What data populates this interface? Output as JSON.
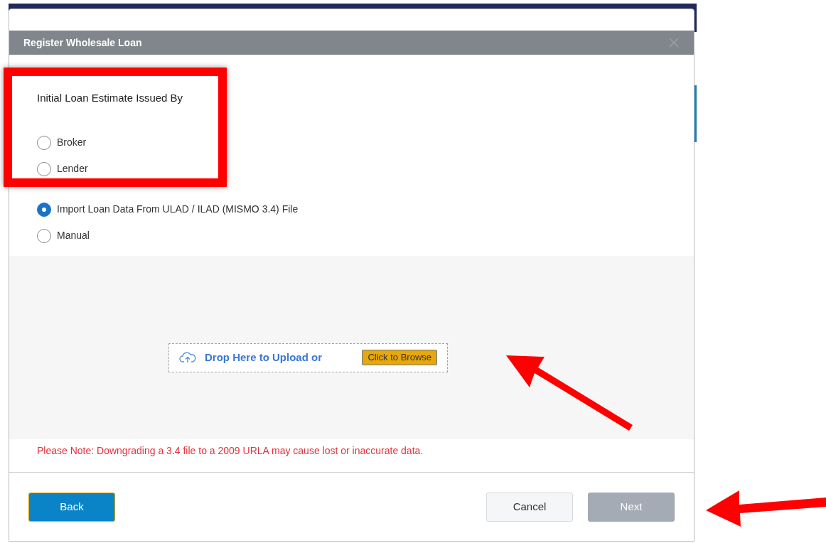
{
  "dialog": {
    "title": "Register Wholesale Loan"
  },
  "issued_by": {
    "label": "Initial Loan Estimate Issued By",
    "options": [
      {
        "label": "Broker",
        "selected": false
      },
      {
        "label": "Lender",
        "selected": false
      }
    ]
  },
  "import_mode": {
    "options": [
      {
        "label": "Import Loan Data From ULAD / ILAD (MISMO 3.4) File",
        "selected": true
      },
      {
        "label": "Manual",
        "selected": false
      }
    ]
  },
  "upload": {
    "text": "Drop Here to Upload or",
    "browse_button": "Click to Browse"
  },
  "note": "Please Note: Downgrading a 3.4 file to a 2009 URLA may cause lost or inaccurate data.",
  "buttons": [
    {
      "kind": "primary",
      "label": "Back",
      "disabled": false
    },
    {
      "kind": "secondary",
      "label": "Cancel",
      "disabled": false
    },
    {
      "kind": "primary",
      "label": "Next",
      "disabled": true
    }
  ]
}
